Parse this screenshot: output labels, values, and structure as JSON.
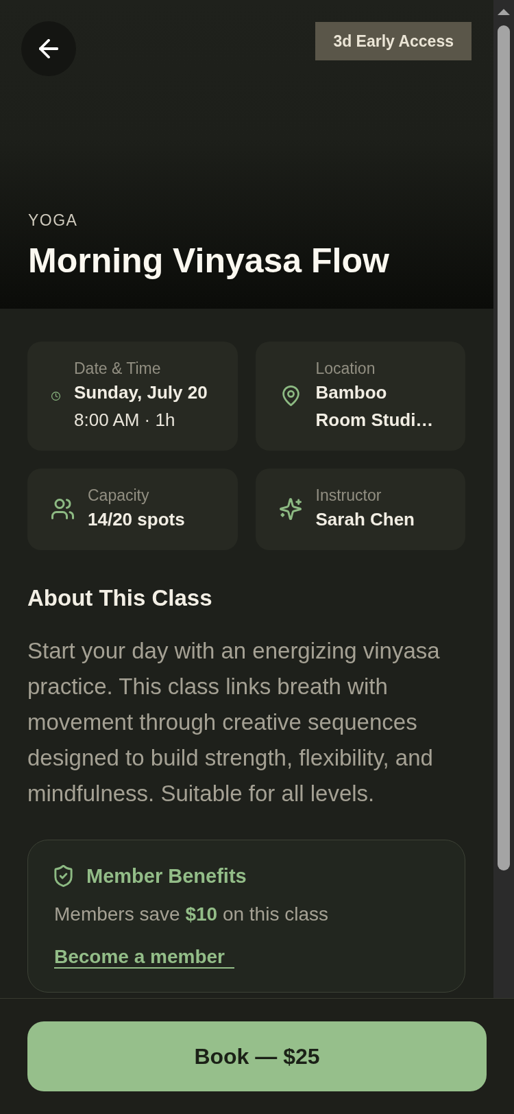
{
  "header": {
    "badge": "3d Early Access",
    "category": "YOGA",
    "title": "Morning Vinyasa Flow"
  },
  "info_cards": [
    {
      "kind": "datetime",
      "label": "Date & Time",
      "value": "Sunday, July 20",
      "detail": "8:00 AM · 1h"
    },
    {
      "kind": "location",
      "label": "Location",
      "value": "Bamboo Room Studi…"
    },
    {
      "kind": "capacity",
      "label": "Capacity",
      "value": "14/20 spots"
    },
    {
      "kind": "instructor",
      "label": "Instructor",
      "value": "Sarah Chen"
    }
  ],
  "about": {
    "heading": "About This Class",
    "text": "Start your day with an energizing vinyasa practice. This class links breath with movement through creative sequences designed to build strength, flexibility, and mindfulness. Suitable for all levels."
  },
  "member_benefits": {
    "title": "Member Benefits",
    "text": "Members save **$10** on this class",
    "link": "Become a member"
  },
  "book_button": "Book — $25"
}
